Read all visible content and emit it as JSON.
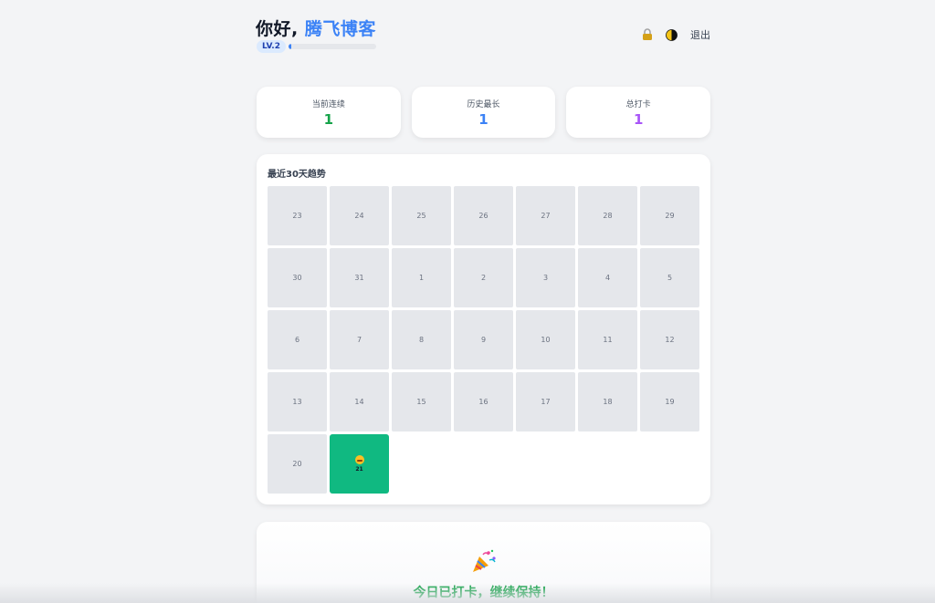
{
  "header": {
    "greeting_prefix": "你好,",
    "username": "腾飞博客",
    "level_badge": "LV.2",
    "xp_progress": 0.03,
    "lock_icon": "lock-icon",
    "theme_icon": "half-moon-theme-icon",
    "logout_label": "退出"
  },
  "stats": [
    {
      "label": "当前连续",
      "value": "1",
      "color": "#16a34a"
    },
    {
      "label": "历史最长",
      "value": "1",
      "color": "#3b82f6"
    },
    {
      "label": "总打卡",
      "value": "1",
      "color": "#a855f7"
    }
  ],
  "trend": {
    "title": "最近30天趋势",
    "days": [
      {
        "day": "23",
        "checked": false
      },
      {
        "day": "24",
        "checked": false
      },
      {
        "day": "25",
        "checked": false
      },
      {
        "day": "26",
        "checked": false
      },
      {
        "day": "27",
        "checked": false
      },
      {
        "day": "28",
        "checked": false
      },
      {
        "day": "29",
        "checked": false
      },
      {
        "day": "30",
        "checked": false
      },
      {
        "day": "31",
        "checked": false
      },
      {
        "day": "1",
        "checked": false
      },
      {
        "day": "2",
        "checked": false
      },
      {
        "day": "3",
        "checked": false
      },
      {
        "day": "4",
        "checked": false
      },
      {
        "day": "5",
        "checked": false
      },
      {
        "day": "6",
        "checked": false
      },
      {
        "day": "7",
        "checked": false
      },
      {
        "day": "8",
        "checked": false
      },
      {
        "day": "9",
        "checked": false
      },
      {
        "day": "10",
        "checked": false
      },
      {
        "day": "11",
        "checked": false
      },
      {
        "day": "12",
        "checked": false
      },
      {
        "day": "13",
        "checked": false
      },
      {
        "day": "14",
        "checked": false
      },
      {
        "day": "15",
        "checked": false
      },
      {
        "day": "16",
        "checked": false
      },
      {
        "day": "17",
        "checked": false
      },
      {
        "day": "18",
        "checked": false
      },
      {
        "day": "19",
        "checked": false
      },
      {
        "day": "20",
        "checked": false
      },
      {
        "day": "21",
        "checked": true,
        "icon": "smile-emoji-icon"
      }
    ]
  },
  "done": {
    "icon": "party-popper-icon",
    "message": "今日已打卡，继续保持！"
  },
  "colors": {
    "accent": "#3b82f6",
    "checked_day": "#10b981",
    "empty_day": "#e5e7eb",
    "success_text": "#16a34a"
  }
}
